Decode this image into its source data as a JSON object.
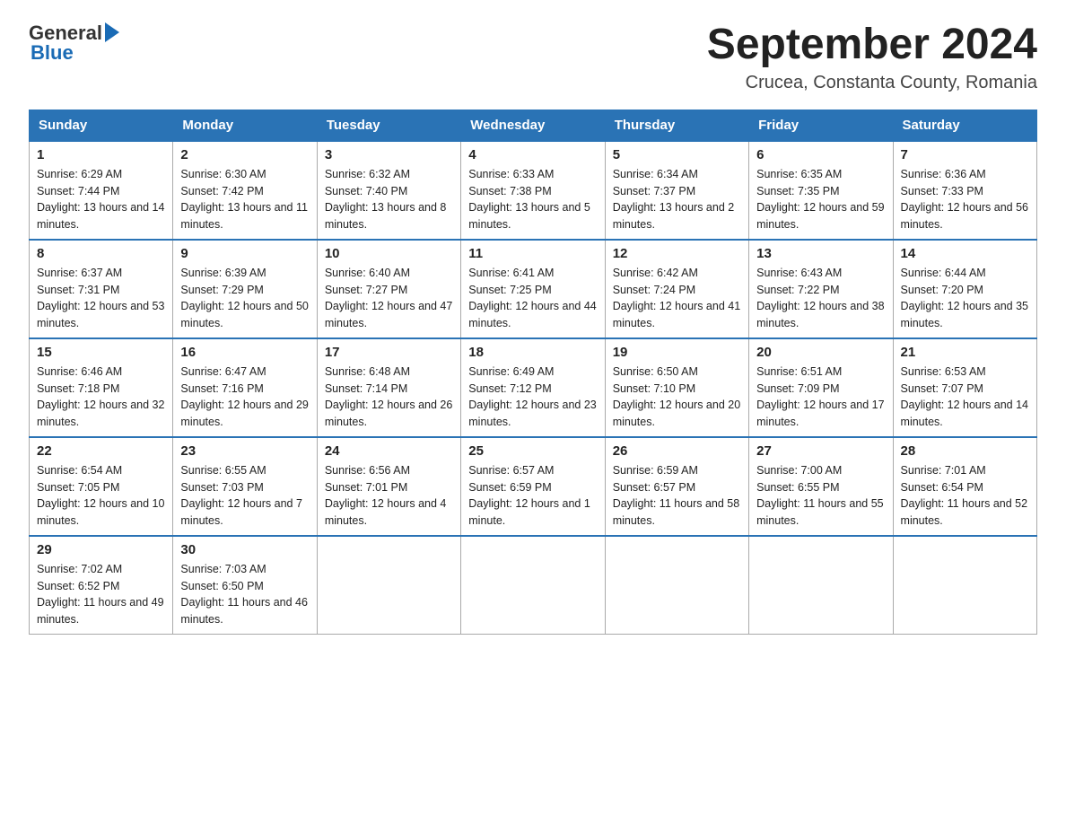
{
  "header": {
    "title": "September 2024",
    "subtitle": "Crucea, Constanta County, Romania",
    "logo_general": "General",
    "logo_blue": "Blue"
  },
  "calendar": {
    "days_of_week": [
      "Sunday",
      "Monday",
      "Tuesday",
      "Wednesday",
      "Thursday",
      "Friday",
      "Saturday"
    ],
    "weeks": [
      [
        {
          "day": "1",
          "sunrise": "6:29 AM",
          "sunset": "7:44 PM",
          "daylight": "13 hours and 14 minutes."
        },
        {
          "day": "2",
          "sunrise": "6:30 AM",
          "sunset": "7:42 PM",
          "daylight": "13 hours and 11 minutes."
        },
        {
          "day": "3",
          "sunrise": "6:32 AM",
          "sunset": "7:40 PM",
          "daylight": "13 hours and 8 minutes."
        },
        {
          "day": "4",
          "sunrise": "6:33 AM",
          "sunset": "7:38 PM",
          "daylight": "13 hours and 5 minutes."
        },
        {
          "day": "5",
          "sunrise": "6:34 AM",
          "sunset": "7:37 PM",
          "daylight": "13 hours and 2 minutes."
        },
        {
          "day": "6",
          "sunrise": "6:35 AM",
          "sunset": "7:35 PM",
          "daylight": "12 hours and 59 minutes."
        },
        {
          "day": "7",
          "sunrise": "6:36 AM",
          "sunset": "7:33 PM",
          "daylight": "12 hours and 56 minutes."
        }
      ],
      [
        {
          "day": "8",
          "sunrise": "6:37 AM",
          "sunset": "7:31 PM",
          "daylight": "12 hours and 53 minutes."
        },
        {
          "day": "9",
          "sunrise": "6:39 AM",
          "sunset": "7:29 PM",
          "daylight": "12 hours and 50 minutes."
        },
        {
          "day": "10",
          "sunrise": "6:40 AM",
          "sunset": "7:27 PM",
          "daylight": "12 hours and 47 minutes."
        },
        {
          "day": "11",
          "sunrise": "6:41 AM",
          "sunset": "7:25 PM",
          "daylight": "12 hours and 44 minutes."
        },
        {
          "day": "12",
          "sunrise": "6:42 AM",
          "sunset": "7:24 PM",
          "daylight": "12 hours and 41 minutes."
        },
        {
          "day": "13",
          "sunrise": "6:43 AM",
          "sunset": "7:22 PM",
          "daylight": "12 hours and 38 minutes."
        },
        {
          "day": "14",
          "sunrise": "6:44 AM",
          "sunset": "7:20 PM",
          "daylight": "12 hours and 35 minutes."
        }
      ],
      [
        {
          "day": "15",
          "sunrise": "6:46 AM",
          "sunset": "7:18 PM",
          "daylight": "12 hours and 32 minutes."
        },
        {
          "day": "16",
          "sunrise": "6:47 AM",
          "sunset": "7:16 PM",
          "daylight": "12 hours and 29 minutes."
        },
        {
          "day": "17",
          "sunrise": "6:48 AM",
          "sunset": "7:14 PM",
          "daylight": "12 hours and 26 minutes."
        },
        {
          "day": "18",
          "sunrise": "6:49 AM",
          "sunset": "7:12 PM",
          "daylight": "12 hours and 23 minutes."
        },
        {
          "day": "19",
          "sunrise": "6:50 AM",
          "sunset": "7:10 PM",
          "daylight": "12 hours and 20 minutes."
        },
        {
          "day": "20",
          "sunrise": "6:51 AM",
          "sunset": "7:09 PM",
          "daylight": "12 hours and 17 minutes."
        },
        {
          "day": "21",
          "sunrise": "6:53 AM",
          "sunset": "7:07 PM",
          "daylight": "12 hours and 14 minutes."
        }
      ],
      [
        {
          "day": "22",
          "sunrise": "6:54 AM",
          "sunset": "7:05 PM",
          "daylight": "12 hours and 10 minutes."
        },
        {
          "day": "23",
          "sunrise": "6:55 AM",
          "sunset": "7:03 PM",
          "daylight": "12 hours and 7 minutes."
        },
        {
          "day": "24",
          "sunrise": "6:56 AM",
          "sunset": "7:01 PM",
          "daylight": "12 hours and 4 minutes."
        },
        {
          "day": "25",
          "sunrise": "6:57 AM",
          "sunset": "6:59 PM",
          "daylight": "12 hours and 1 minute."
        },
        {
          "day": "26",
          "sunrise": "6:59 AM",
          "sunset": "6:57 PM",
          "daylight": "11 hours and 58 minutes."
        },
        {
          "day": "27",
          "sunrise": "7:00 AM",
          "sunset": "6:55 PM",
          "daylight": "11 hours and 55 minutes."
        },
        {
          "day": "28",
          "sunrise": "7:01 AM",
          "sunset": "6:54 PM",
          "daylight": "11 hours and 52 minutes."
        }
      ],
      [
        {
          "day": "29",
          "sunrise": "7:02 AM",
          "sunset": "6:52 PM",
          "daylight": "11 hours and 49 minutes."
        },
        {
          "day": "30",
          "sunrise": "7:03 AM",
          "sunset": "6:50 PM",
          "daylight": "11 hours and 46 minutes."
        },
        null,
        null,
        null,
        null,
        null
      ]
    ]
  }
}
